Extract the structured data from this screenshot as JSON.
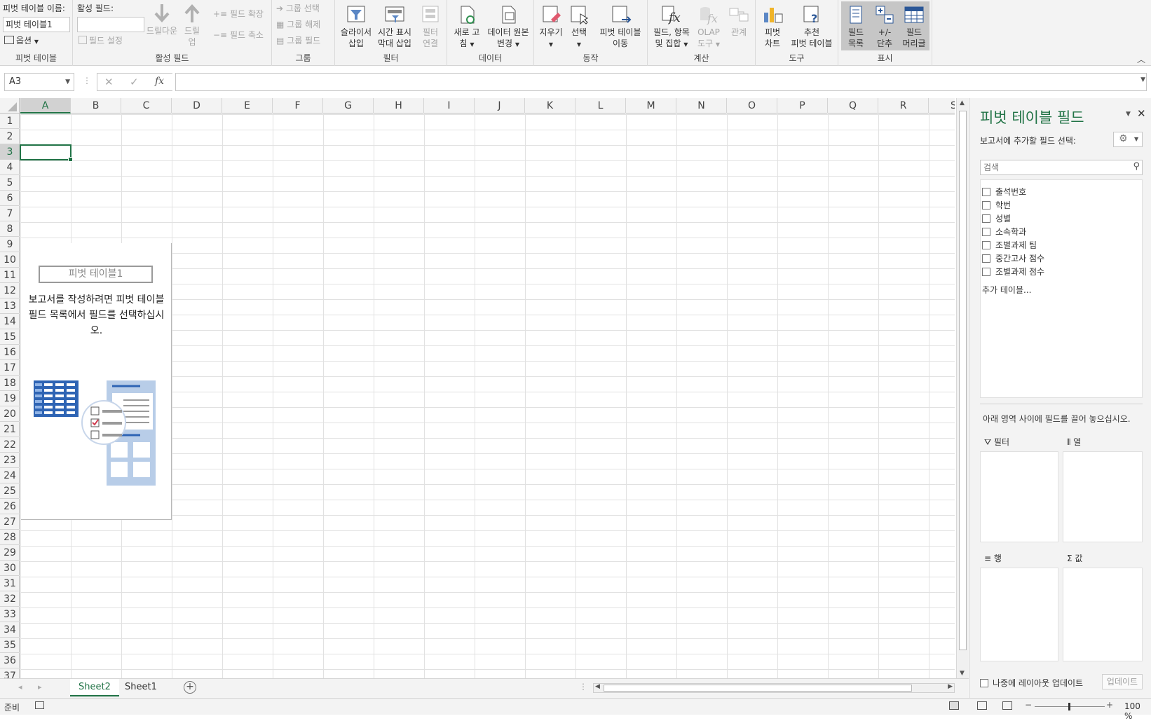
{
  "ribbon": {
    "pivot_name_label": "피벗 테이블 이름:",
    "pivot_name_value": "피벗 테이블1",
    "options_label": "옵션",
    "group_pivot_table": "피벗 테이블",
    "active_field_label": "활성 필드:",
    "active_field_value": "",
    "field_settings": "필드 설정",
    "drill_down": "드릴다운",
    "drill_up_1": "드릴",
    "drill_up_2": "업",
    "expand_field": "필드 확장",
    "collapse_field": "필드 축소",
    "group_active_field": "활성 필드",
    "group_selection": "그룹 선택",
    "ungroup": "그룹 해제",
    "group_field": "그룹 필드",
    "group_group": "그룹",
    "slicer_1": "슬라이서",
    "slicer_2": "삽입",
    "timeline_1": "시간 표시",
    "timeline_2": "막대 삽입",
    "filter_conn_1": "필터",
    "filter_conn_2": "연결",
    "group_filter": "필터",
    "refresh_1": "새로 고",
    "refresh_2": "침",
    "change_source_1": "데이터 원본",
    "change_source_2": "변경",
    "group_data": "데이터",
    "clear": "지우기",
    "select": "선택",
    "move_1": "피벗 테이블",
    "move_2": "이동",
    "group_actions": "동작",
    "fields_items_1": "필드, 항목",
    "fields_items_2": "및 집합",
    "olap_1": "OLAP",
    "olap_2": "도구",
    "relationships": "관계",
    "group_calc": "계산",
    "pivot_chart_1": "피벗",
    "pivot_chart_2": "차트",
    "recommended_1": "추천",
    "recommended_2": "피벗 테이블",
    "group_tools": "도구",
    "field_list_1": "필드",
    "field_list_2": "목록",
    "buttons_1": "+/-",
    "buttons_2": "단추",
    "headers_1": "필드",
    "headers_2": "머리글",
    "group_show": "표시"
  },
  "formula_bar": {
    "name_box": "A3",
    "fx": "fx",
    "formula": ""
  },
  "sheet": {
    "columns": [
      "A",
      "B",
      "C",
      "D",
      "E",
      "F",
      "G",
      "H",
      "I",
      "J",
      "K",
      "L",
      "M",
      "N",
      "O",
      "P",
      "Q",
      "R",
      "S"
    ],
    "rows": [
      "1",
      "2",
      "3",
      "4",
      "5",
      "6",
      "7",
      "8",
      "9",
      "10",
      "11",
      "12",
      "13",
      "14",
      "15",
      "16",
      "17",
      "18",
      "19",
      "20",
      "21",
      "22",
      "23",
      "24",
      "25",
      "26",
      "27",
      "28",
      "29",
      "30",
      "31",
      "32",
      "33",
      "34",
      "35",
      "36",
      "37"
    ],
    "pivot_placeholder_name": "피벗 테이블1",
    "pivot_placeholder_desc": "보고서를 작성하려면 피벗 테이블 필드 목록에서 필드를 선택하십시오."
  },
  "tabs": {
    "items": [
      "Sheet2",
      "Sheet1"
    ],
    "active": "Sheet2"
  },
  "status": {
    "ready": "준비",
    "zoom": "100 %"
  },
  "pane": {
    "title": "피벗 테이블 필드",
    "subtitle": "보고서에 추가할 필드 선택:",
    "search_placeholder": "검색",
    "fields": [
      "출석번호",
      "학번",
      "성별",
      "소속학과",
      "조별과제 팀",
      "중간고사 점수",
      "조별과제 점수"
    ],
    "more_tables": "추가 테이블...",
    "drag_hint": "아래 영역 사이에 필드를 끌어 놓으십시오.",
    "area_filter": "필터",
    "area_columns": "열",
    "area_rows": "행",
    "area_values": "값",
    "defer_update": "나중에 레이아웃 업데이트",
    "update_button": "업데이트"
  },
  "colors": {
    "accent": "#217346",
    "ribbon_bg": "#f3f3f3"
  }
}
